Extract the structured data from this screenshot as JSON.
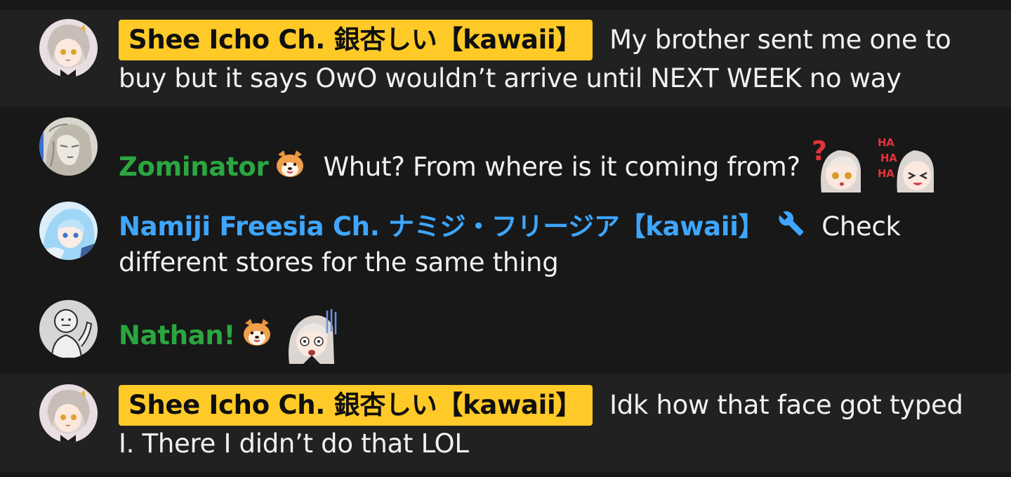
{
  "messages": [
    {
      "author": "Shee Icho Ch. 銀杏しい【kawaii】",
      "text": "My brother sent me one to buy but it says OwO wouldn’t arrive until NEXT WEEK no way",
      "role": "owner"
    },
    {
      "author": "Zominator",
      "badge": "shiba-emoji",
      "text": "Whut? From where is it coming from?",
      "role": "member",
      "stickers": [
        "question-sticker",
        "laugh-sticker"
      ]
    },
    {
      "author": "Namiji Freesia Ch. ナミジ・フリージア【kawaii】",
      "badge": "wrench-icon",
      "text": "Check different stores for the same thing",
      "role": "moderator"
    },
    {
      "author": "Nathan!",
      "badge": "shiba-emoji",
      "text": "",
      "role": "member",
      "stickers": [
        "shocked-sticker"
      ]
    },
    {
      "author": "Shee Icho Ch. 銀杏しい【kawaii】",
      "text": "Idk how that face got typed I. There I didn’t do that LOL",
      "role": "owner"
    }
  ],
  "colors": {
    "owner_chip": "#ffca28",
    "member_name": "#2ba640",
    "moderator_name": "#3ea6ff",
    "owner_row_bg": "#212121",
    "row_bg": "#181818"
  }
}
